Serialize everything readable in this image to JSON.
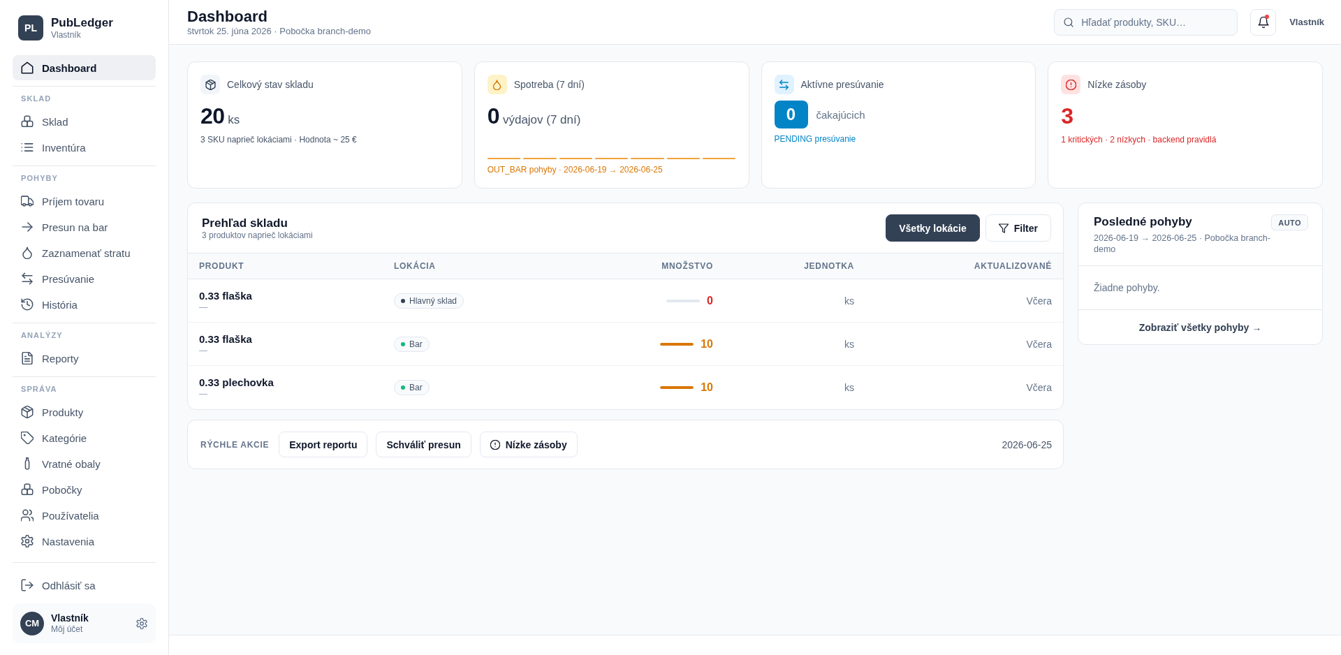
{
  "sidebar": {
    "brand": {
      "initials": "PL",
      "name": "PubLedger",
      "subtitle": "Vlastník"
    },
    "sections": [
      {
        "items": [
          {
            "label": "Dashboard",
            "selected": true
          }
        ]
      },
      {
        "heading": "SKLAD",
        "items": [
          {
            "label": "Sklad",
            "selected": false
          },
          {
            "label": "Inventúra",
            "selected": false
          }
        ]
      },
      {
        "heading": "POHYBY",
        "items": [
          {
            "label": "Príjem tovaru",
            "selected": false
          },
          {
            "label": "Presun na bar",
            "selected": false
          },
          {
            "label": "Zaznamenať stratu",
            "selected": false
          },
          {
            "label": "Presúvanie",
            "selected": false
          },
          {
            "label": "História",
            "selected": false
          }
        ]
      },
      {
        "heading": "ANALÝZY",
        "items": [
          {
            "label": "Reporty",
            "selected": false
          }
        ]
      },
      {
        "heading": "SPRÁVA",
        "items": [
          {
            "label": "Produkty",
            "selected": false
          },
          {
            "label": "Kategórie",
            "selected": false
          },
          {
            "label": "Vratné obaly",
            "selected": false
          },
          {
            "label": "Pobočky",
            "selected": false
          },
          {
            "label": "Používatelia",
            "selected": false
          },
          {
            "label": "Nastavenia",
            "selected": false
          }
        ]
      }
    ],
    "logout": "Odhlásiť sa",
    "user": {
      "initials": "CM",
      "name": "Vlastník",
      "subtitle": "Môj účet"
    }
  },
  "header": {
    "title": "Dashboard",
    "subtitle": "štvrtok 25. júna 2026 · Pobočka branch-demo",
    "search": {
      "placeholder": "Hľadať produkty, SKU…"
    },
    "unread_notifications": true,
    "user": "Vlastník"
  },
  "stats": [
    {
      "kind": "total",
      "label": "Celkový stav skladu",
      "value": "20",
      "unit": "ks",
      "note": "3 SKU naprieč lokáciami · Hodnota ~ 25 €"
    },
    {
      "kind": "consumption",
      "label": "Spotreba (7 dní)",
      "value": "0",
      "unit": "výdajov (7 dní)",
      "note": "OUT_BAR pohyby · 2026-06-19 → 2026-06-25"
    },
    {
      "kind": "transfers",
      "label": "Aktívne presúvanie",
      "value": "0",
      "unit": "čakajúcich",
      "note": "PENDING presúvanie"
    },
    {
      "kind": "low_stock",
      "label": "Nízke zásoby",
      "value": "3",
      "note": "1 kritických · 2 nízkych · backend pravidlá"
    }
  ],
  "inventory": {
    "title": "Prehľad skladu",
    "subtitle": "3 produktov naprieč lokáciami",
    "actions": [
      {
        "kind": "primary",
        "label": "Všetky lokácie"
      },
      {
        "kind": "filter",
        "label": "Filter"
      }
    ],
    "columns": [
      "PRODUKT",
      "LOKÁCIA",
      "MNOŽSTVO",
      "JEDNOTKA",
      "AKTUALIZOVANÉ"
    ],
    "rows": [
      {
        "product": "0.33 flaška",
        "detail": "—",
        "location": {
          "name": "Hlavný sklad",
          "color": "#334155"
        },
        "critical": true,
        "quantity": "0",
        "unit": "ks",
        "updated": "Včera"
      },
      {
        "product": "0.33 flaška",
        "detail": "—",
        "location": {
          "name": "Bar",
          "color": "#10b981"
        },
        "level": 1,
        "critical": false,
        "quantity": "10",
        "unit": "ks",
        "updated": "Včera"
      },
      {
        "product": "0.33 plechovka",
        "detail": "—",
        "location": {
          "name": "Bar",
          "color": "#10b981"
        },
        "level": 1,
        "critical": false,
        "quantity": "10",
        "unit": "ks",
        "updated": "Včera"
      }
    ]
  },
  "quick_actions": {
    "heading": "RÝCHLE AKCIE",
    "buttons": [
      {
        "kind": "plain",
        "label": "Export reportu"
      },
      {
        "kind": "plain",
        "label": "Schváliť presun"
      },
      {
        "kind": "alert",
        "label": "Nízke zásoby"
      }
    ],
    "date": "2026-06-25"
  },
  "recent_movements": {
    "title": "Posledné pohyby",
    "badge": "AUTO",
    "subtitle": "2026-06-19 → 2026-06-25 · Pobočka branch-demo",
    "empty": "Žiadne pohyby.",
    "link": "Zobraziť všetky pohyby →"
  }
}
